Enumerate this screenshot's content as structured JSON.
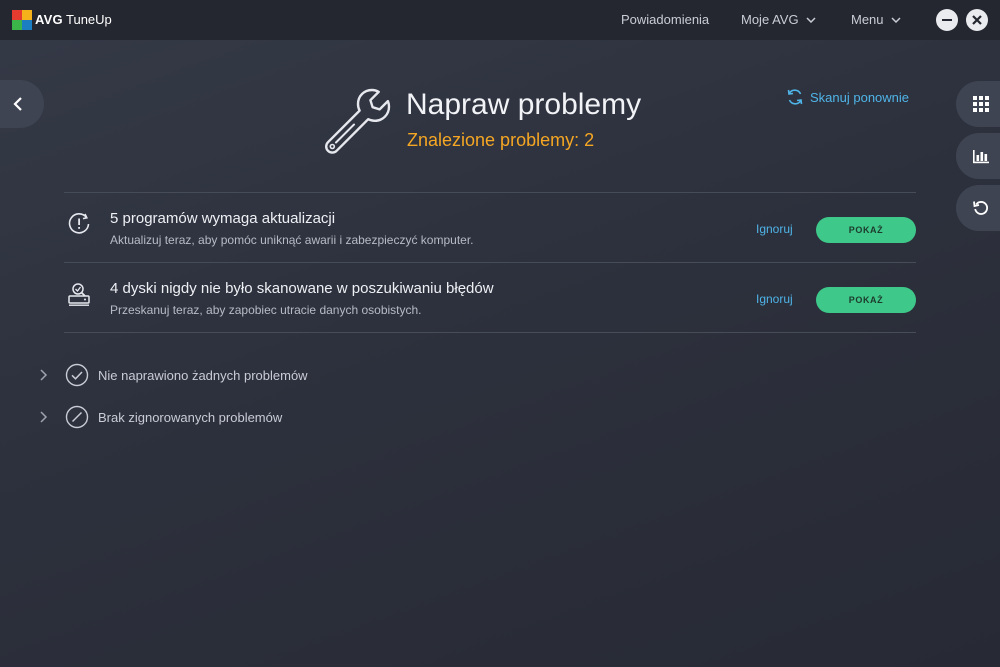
{
  "app": {
    "brand": "AVG",
    "product": "TuneUp",
    "logo_colors": [
      "#e63c2f",
      "#f6b21a",
      "#3bb54a",
      "#1c7ec2"
    ]
  },
  "topnav": {
    "notifications": "Powiadomienia",
    "my_avg": "Moje AVG",
    "menu": "Menu"
  },
  "header": {
    "title": "Napraw problemy",
    "subtitle": "Znalezione problemy: 2",
    "rescan": "Skanuj ponownie",
    "accent": "#f5a623",
    "link_color": "#4fb4e8"
  },
  "issues": [
    {
      "icon": "clock-alert-icon",
      "title": "5 programów wymaga aktualizacji",
      "description": "Aktualizuj teraz, aby pomóc uniknąć awarii i zabezpieczyć komputer.",
      "ignore": "Ignoruj",
      "action": "POKAŻ"
    },
    {
      "icon": "disk-scan-icon",
      "title": "4 dyski nigdy nie było skanowane w poszukiwaniu błędów",
      "description": "Przeskanuj teraz, aby zapobiec utracie danych osobistych.",
      "ignore": "Ignoruj",
      "action": "POKAŻ"
    }
  ],
  "sections": {
    "fixed": "Nie naprawiono żadnych problemów",
    "ignored": "Brak zignorowanych problemów"
  },
  "action_color": "#3ec98a"
}
